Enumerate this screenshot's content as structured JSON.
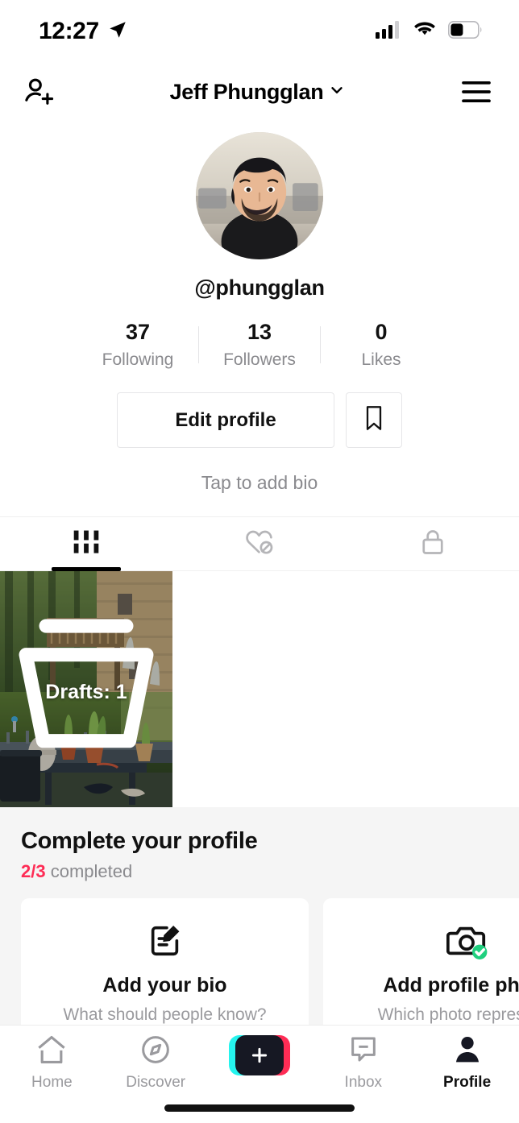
{
  "status_bar": {
    "time": "12:27",
    "location_icon": "location-arrow-icon",
    "signal_icon": "cellular-signal-icon",
    "wifi_icon": "wifi-icon",
    "battery_icon": "battery-icon",
    "battery_level_pct": 42
  },
  "header": {
    "add_friend_icon": "add-friend-icon",
    "title": "Jeff Phungglan",
    "chevron_icon": "chevron-down-icon",
    "menu_icon": "hamburger-menu-icon"
  },
  "profile": {
    "avatar_alt": "profile-photo",
    "handle": "@phungglan",
    "stats": [
      {
        "value": "37",
        "label": "Following"
      },
      {
        "value": "13",
        "label": "Followers"
      },
      {
        "value": "0",
        "label": "Likes"
      }
    ],
    "edit_button": "Edit profile",
    "bookmark_icon": "bookmark-icon",
    "bio_placeholder": "Tap to add bio"
  },
  "content_tabs": [
    {
      "name": "videos",
      "icon": "grid-icon",
      "active": true
    },
    {
      "name": "liked",
      "icon": "heart-hidden-icon",
      "active": false
    },
    {
      "name": "private",
      "icon": "lock-icon",
      "active": false
    }
  ],
  "grid": {
    "draft": {
      "icon": "drafts-folder-icon",
      "label": "Drafts: 1"
    }
  },
  "complete_profile": {
    "title": "Complete your profile",
    "progress_fraction": "2/3",
    "progress_suffix": " completed",
    "accent_color": "#fe2c55",
    "cards": [
      {
        "icon": "edit-note-icon",
        "title": "Add your bio",
        "description": "What should people know?",
        "completed": false
      },
      {
        "icon": "camera-icon",
        "title": "Add profile photo",
        "description": "Which photo represents",
        "completed": true,
        "check_color": "#20d07f"
      }
    ]
  },
  "bottom_nav": [
    {
      "label": "Home",
      "icon": "home-icon",
      "active": false
    },
    {
      "label": "Discover",
      "icon": "compass-icon",
      "active": false
    },
    {
      "label": "",
      "icon": "create-plus-icon",
      "active": false
    },
    {
      "label": "Inbox",
      "icon": "inbox-icon",
      "active": false
    },
    {
      "label": "Profile",
      "icon": "person-icon",
      "active": true
    }
  ]
}
